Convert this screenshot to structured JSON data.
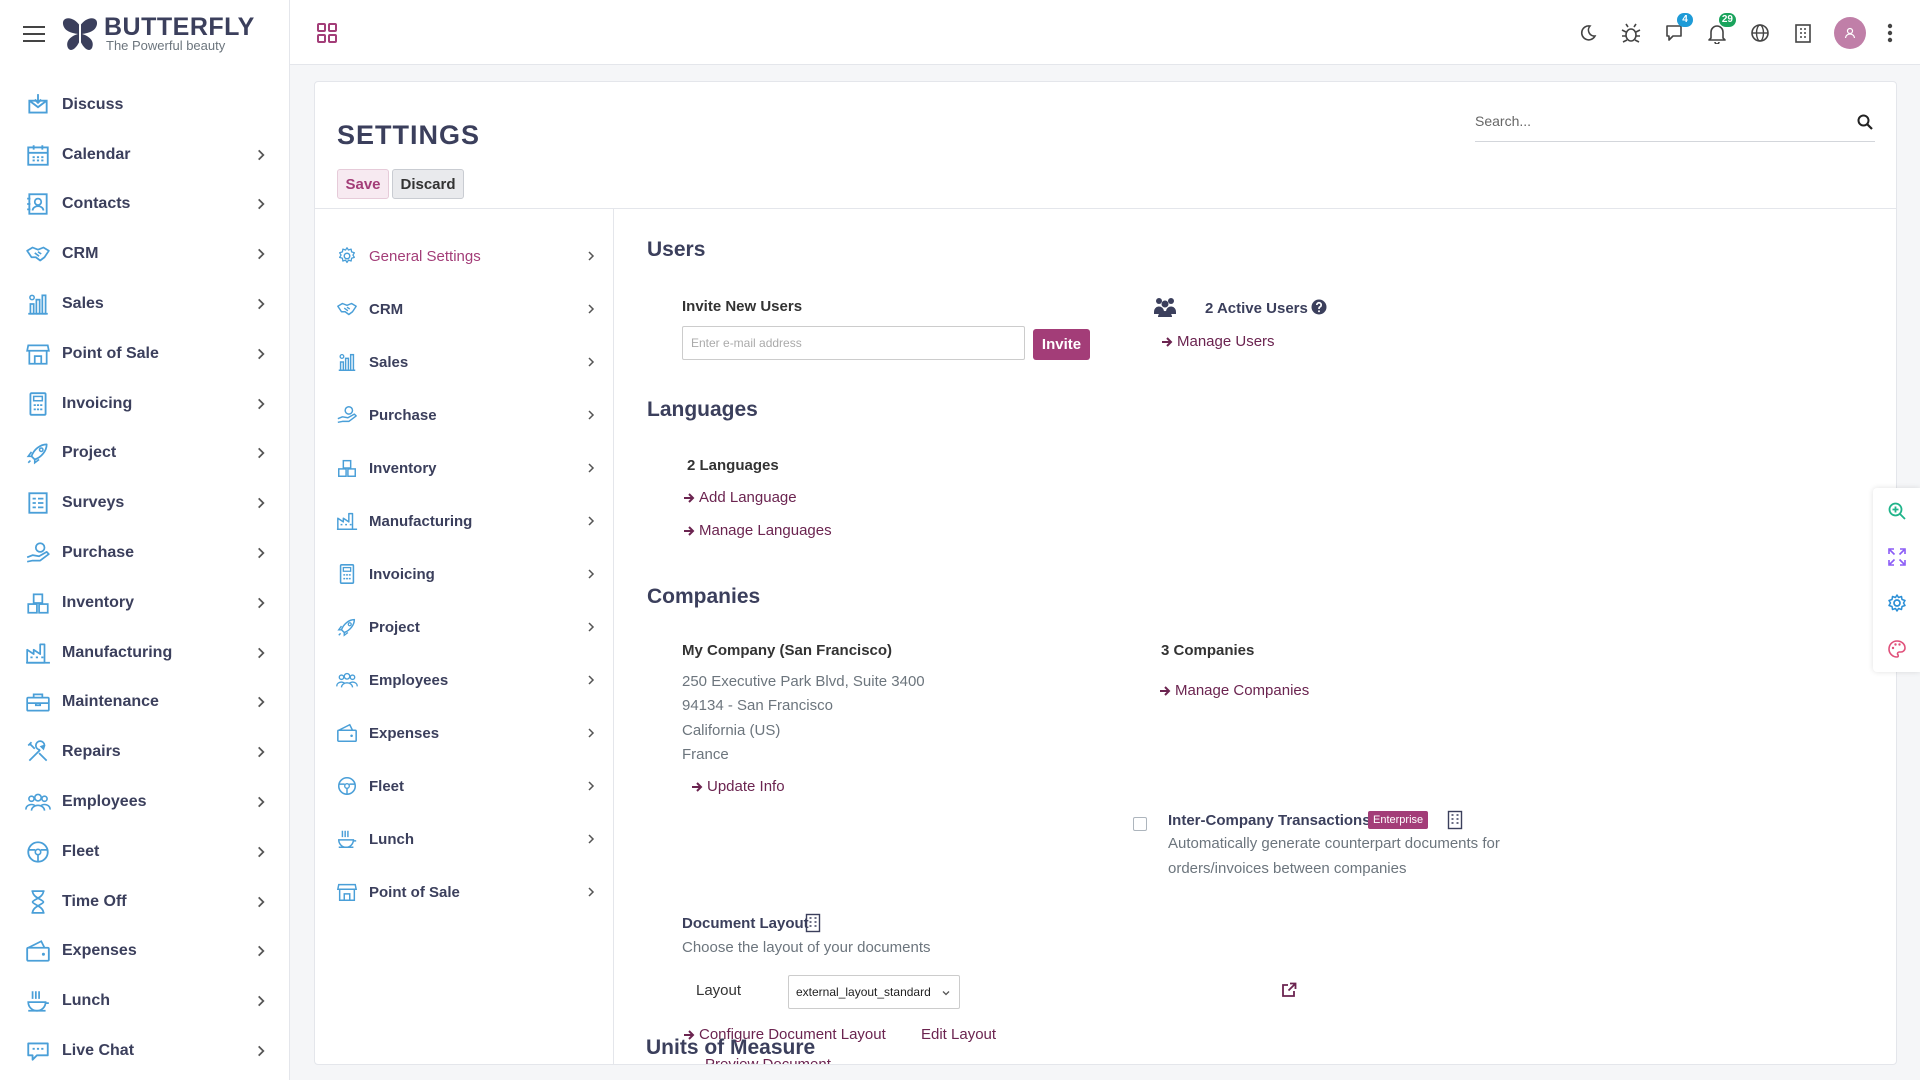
{
  "brand": {
    "name": "BUTTERFLY",
    "tagline": "The Powerful beauty"
  },
  "sidebar": {
    "items": [
      {
        "label": "Discuss",
        "icon": "discuss-icon",
        "has_children": false
      },
      {
        "label": "Calendar",
        "icon": "calendar-icon",
        "has_children": true
      },
      {
        "label": "Contacts",
        "icon": "contacts-icon",
        "has_children": true
      },
      {
        "label": "CRM",
        "icon": "handshake-icon",
        "has_children": true
      },
      {
        "label": "Sales",
        "icon": "sales-icon",
        "has_children": true
      },
      {
        "label": "Point of Sale",
        "icon": "store-icon",
        "has_children": true
      },
      {
        "label": "Invoicing",
        "icon": "invoice-icon",
        "has_children": true
      },
      {
        "label": "Project",
        "icon": "rocket-icon",
        "has_children": true
      },
      {
        "label": "Surveys",
        "icon": "survey-icon",
        "has_children": true
      },
      {
        "label": "Purchase",
        "icon": "purchase-icon",
        "has_children": true
      },
      {
        "label": "Inventory",
        "icon": "boxes-icon",
        "has_children": true
      },
      {
        "label": "Manufacturing",
        "icon": "factory-icon",
        "has_children": true
      },
      {
        "label": "Maintenance",
        "icon": "toolbox-icon",
        "has_children": true
      },
      {
        "label": "Repairs",
        "icon": "tools-icon",
        "has_children": true
      },
      {
        "label": "Employees",
        "icon": "team-icon",
        "has_children": true
      },
      {
        "label": "Fleet",
        "icon": "steering-wheel-icon",
        "has_children": true
      },
      {
        "label": "Time Off",
        "icon": "hourglass-icon",
        "has_children": true
      },
      {
        "label": "Expenses",
        "icon": "wallet-icon",
        "has_children": true
      },
      {
        "label": "Lunch",
        "icon": "lunch-icon",
        "has_children": true
      },
      {
        "label": "Live Chat",
        "icon": "chat-icon",
        "has_children": true
      }
    ]
  },
  "topbar": {
    "icons": [
      "moon-icon",
      "bug-icon",
      "chat-bubble-icon",
      "bell-icon",
      "globe-icon",
      "building-icon"
    ],
    "messages_badge": "4",
    "notifications_badge": "29",
    "colors": {
      "messages_badge": "#1e9bd7",
      "notifications_badge": "#1aa35c"
    }
  },
  "page": {
    "title": "SETTINGS",
    "save_label": "Save",
    "discard_label": "Discard",
    "search_placeholder": "Search..."
  },
  "settings_nav": [
    {
      "label": "General Settings",
      "active": true
    },
    {
      "label": "CRM",
      "active": false
    },
    {
      "label": "Sales",
      "active": false
    },
    {
      "label": "Purchase",
      "active": false
    },
    {
      "label": "Inventory",
      "active": false
    },
    {
      "label": "Manufacturing",
      "active": false
    },
    {
      "label": "Invoicing",
      "active": false
    },
    {
      "label": "Project",
      "active": false
    },
    {
      "label": "Employees",
      "active": false
    },
    {
      "label": "Expenses",
      "active": false
    },
    {
      "label": "Fleet",
      "active": false
    },
    {
      "label": "Lunch",
      "active": false
    },
    {
      "label": "Point of Sale",
      "active": false
    }
  ],
  "users": {
    "title": "Users",
    "invite_label": "Invite New Users",
    "email_placeholder": "Enter e-mail address",
    "invite_button": "Invite",
    "active_users": "2 Active Users",
    "manage_users": "Manage Users"
  },
  "languages": {
    "title": "Languages",
    "count": "2 Languages",
    "add": "Add Language",
    "manage": "Manage Languages"
  },
  "companies": {
    "title": "Companies",
    "company_name": "My Company (San Francisco)",
    "address_line1": "250 Executive Park Blvd, Suite 3400",
    "address_line2": "94134 - San Francisco",
    "address_line3": "California (US)",
    "address_line4": "France",
    "update_info": "Update Info",
    "count": "3 Companies",
    "manage": "Manage Companies",
    "inter_company_title": "Inter-Company Transactions",
    "enterprise_badge": "Enterprise",
    "inter_company_desc1": "Automatically generate counterpart documents for",
    "inter_company_desc2": "orders/invoices between companies",
    "inter_company_checked": false,
    "doc_layout_title": "Document Layout",
    "doc_layout_desc": "Choose the layout of your documents",
    "layout_label": "Layout",
    "layout_value": "external_layout_standard",
    "configure": "Configure Document Layout",
    "edit_layout": "Edit Layout",
    "preview": "Preview Document"
  },
  "units": {
    "title": "Units of Measure"
  },
  "colors": {
    "accent": "#a33d78",
    "link": "#6b2450",
    "icon": "#4a9fd8",
    "heading": "#3b3f5c"
  }
}
